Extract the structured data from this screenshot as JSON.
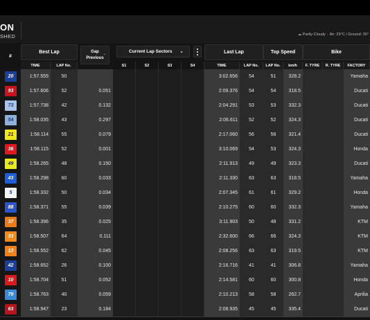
{
  "header": {
    "title": "ON",
    "subtitle": "SHED",
    "weather": "Partly-Cloudy",
    "temps": "Air: 29°C / Ground: 36°"
  },
  "columns": {
    "pos": "#",
    "best_lap": "Best Lap",
    "best_time": "TIME",
    "best_lapno": "LAP No.",
    "gap": "Gap",
    "gap_mode": "Previous",
    "sectors_title": "Current Lap Sectors",
    "s1": "S1",
    "s2": "S2",
    "s3": "S3",
    "s4": "S4",
    "last_lap": "Last Lap",
    "last_time": "TIME",
    "last_lapno": "LAP No.",
    "top_speed": "Top Speed",
    "speed_lapno": "LAP No.",
    "kmh": "km/h",
    "bike": "Bike",
    "ftyre": "F. TYRE",
    "rtyre": "R. TYRE",
    "factory": "FACTORY"
  },
  "rows": [
    {
      "num": "20",
      "bg": "#1b3f9a",
      "fg": "#ffffff",
      "best": "1:57.555",
      "lap": "50",
      "gap": "",
      "last": "3:02.656",
      "llap": "54",
      "slap": "51",
      "speed": "328.2",
      "factory": "Yamaha"
    },
    {
      "num": "93",
      "bg": "#c8141e",
      "fg": "#ffffff",
      "best": "1:57.606",
      "lap": "52",
      "gap": "0.051",
      "last": "2:09.376",
      "llap": "54",
      "slap": "54",
      "speed": "318.5",
      "factory": "Ducati"
    },
    {
      "num": "73",
      "bg": "#a9c4ea",
      "fg": "#1e3a78",
      "best": "1:57.738",
      "lap": "42",
      "gap": "0.132",
      "last": "2:04.291",
      "llap": "53",
      "slap": "53",
      "speed": "332.3",
      "factory": "Ducati"
    },
    {
      "num": "54",
      "bg": "#8fb0d8",
      "fg": "#1e3a78",
      "best": "1:58.035",
      "lap": "43",
      "gap": "0.297",
      "last": "2:06.611",
      "llap": "52",
      "slap": "52",
      "speed": "324.3",
      "factory": "Ducati"
    },
    {
      "num": "21",
      "bg": "#f2e51a",
      "fg": "#222222",
      "best": "1:58.114",
      "lap": "55",
      "gap": "0.079",
      "last": "2:17.060",
      "llap": "56",
      "slap": "56",
      "speed": "321.4",
      "factory": "Ducati"
    },
    {
      "num": "36",
      "bg": "#e0181f",
      "fg": "#ffffff",
      "best": "1:58.115",
      "lap": "52",
      "gap": "0.001",
      "last": "3:10.069",
      "llap": "54",
      "slap": "53",
      "speed": "324.3",
      "factory": "Honda"
    },
    {
      "num": "49",
      "bg": "#e8ec1a",
      "fg": "#222222",
      "best": "1:58.265",
      "lap": "48",
      "gap": "0.150",
      "last": "2:11.913",
      "llap": "49",
      "slap": "49",
      "speed": "323.3",
      "factory": "Ducati"
    },
    {
      "num": "43",
      "bg": "#1e5fd8",
      "fg": "#ffffff",
      "best": "1:58.298",
      "lap": "60",
      "gap": "0.033",
      "last": "2:11.330",
      "llap": "63",
      "slap": "63",
      "speed": "318.5",
      "factory": "Yamaha"
    },
    {
      "num": "5",
      "bg": "#f4f4f4",
      "fg": "#1b3f9a",
      "best": "1:58.332",
      "lap": "50",
      "gap": "0.034",
      "last": "2:07.345",
      "llap": "61",
      "slap": "61",
      "speed": "329.2",
      "factory": "Honda"
    },
    {
      "num": "88",
      "bg": "#2a54c8",
      "fg": "#ffffff",
      "best": "1:58.371",
      "lap": "55",
      "gap": "0.039",
      "last": "2:10.275",
      "llap": "60",
      "slap": "60",
      "speed": "332.3",
      "factory": "Yamaha"
    },
    {
      "num": "37",
      "bg": "#f07a18",
      "fg": "#ffffff",
      "best": "1:58.396",
      "lap": "35",
      "gap": "0.025",
      "last": "3:11.903",
      "llap": "50",
      "slap": "48",
      "speed": "331.2",
      "factory": "KTM"
    },
    {
      "num": "33",
      "bg": "#f08a1a",
      "fg": "#ffffff",
      "best": "1:58.507",
      "lap": "64",
      "gap": "0.111",
      "last": "2:32.600",
      "llap": "66",
      "slap": "66",
      "speed": "324.3",
      "factory": "KTM"
    },
    {
      "num": "12",
      "bg": "#f08218",
      "fg": "#ffffff",
      "best": "1:58.552",
      "lap": "62",
      "gap": "0.045",
      "last": "2:08.256",
      "llap": "63",
      "slap": "63",
      "speed": "319.5",
      "factory": "KTM"
    },
    {
      "num": "42",
      "bg": "#1b3f9a",
      "fg": "#ffffff",
      "best": "1:58.652",
      "lap": "26",
      "gap": "0.100",
      "last": "2:16.716",
      "llap": "41",
      "slap": "41",
      "speed": "306.8",
      "factory": "Yamaha"
    },
    {
      "num": "10",
      "bg": "#d81a1a",
      "fg": "#ffffff",
      "best": "1:58.704",
      "lap": "51",
      "gap": "0.052",
      "last": "2:14.581",
      "llap": "60",
      "slap": "60",
      "speed": "300.8",
      "factory": "Honda"
    },
    {
      "num": "79",
      "bg": "#3a8ad8",
      "fg": "#ffffff",
      "best": "1:58.763",
      "lap": "40",
      "gap": "0.059",
      "last": "2:10.213",
      "llap": "58",
      "slap": "58",
      "speed": "262.7",
      "factory": "Aprilia"
    },
    {
      "num": "63",
      "bg": "#b8141e",
      "fg": "#ffffff",
      "best": "1:58.947",
      "lap": "23",
      "gap": "0.184",
      "last": "2:08.935",
      "llap": "45",
      "slap": "45",
      "speed": "335.4",
      "factory": "Ducati"
    }
  ]
}
